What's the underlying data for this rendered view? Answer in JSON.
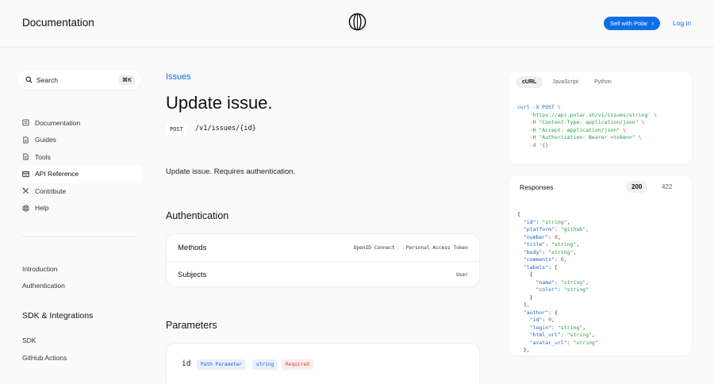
{
  "header": {
    "brand": "Documentation",
    "cta_label": "Sell with Polar",
    "login_label": "Log in",
    "accent": "#0d6fe8"
  },
  "sidebar": {
    "search": {
      "label": "Search",
      "shortcut": "⌘K"
    },
    "nav": [
      {
        "label": "Documentation",
        "icon": "book-icon"
      },
      {
        "label": "Guides",
        "icon": "file-icon"
      },
      {
        "label": "Tools",
        "icon": "file-icon"
      },
      {
        "label": "API Reference",
        "icon": "terminal-icon",
        "active": true
      },
      {
        "label": "Contribute",
        "icon": "tools-icon"
      },
      {
        "label": "Help",
        "icon": "lifebuoy-icon"
      }
    ],
    "links": [
      "Introduction",
      "Authentication"
    ],
    "section_title": "SDK & Integrations",
    "section_links": [
      "SDK",
      "GitHub Actions"
    ]
  },
  "main": {
    "breadcrumb": "Issues",
    "title": "Update issue.",
    "method": "POST",
    "path": "/v1/issues/{id}",
    "description": "Update issue. Requires authentication.",
    "auth_heading": "Authentication",
    "auth_rows": [
      {
        "key": "Methods",
        "values": [
          "OpenID Connect",
          "Personal Access Token"
        ]
      },
      {
        "key": "Subjects",
        "values": [
          "User"
        ]
      }
    ],
    "params_heading": "Parameters",
    "param": {
      "name": "id",
      "location": "Path Parameter",
      "type": "string",
      "required": "Required"
    }
  },
  "code_panel": {
    "tabs": [
      "cURL",
      "JavaScript",
      "Python"
    ],
    "active_tab": "cURL",
    "lines": [
      [
        [
          "curl -X POST ",
          "blue"
        ],
        [
          "\\",
          "red"
        ]
      ],
      [
        [
          "    'https://api.polar.sh/v1/issues/string' ",
          "green"
        ],
        [
          "\\",
          "red"
        ]
      ],
      [
        [
          "    -H \"Content-Type: application/json\" ",
          "green"
        ],
        [
          "\\",
          "red"
        ]
      ],
      [
        [
          "    -H \"Accept: application/json\" ",
          "green"
        ],
        [
          "\\",
          "red"
        ]
      ],
      [
        [
          "    -H \"Authorization: Bearer <token>\" ",
          "green"
        ],
        [
          "\\",
          "red"
        ]
      ],
      [
        [
          "    -d '{}'",
          "green"
        ]
      ]
    ]
  },
  "responses": {
    "title": "Responses",
    "tabs": [
      "200",
      "422"
    ],
    "active_tab": "200",
    "lines": [
      [
        [
          "{",
          "dark"
        ]
      ],
      [
        [
          "  \"id\"",
          "blue"
        ],
        [
          ": ",
          "dark"
        ],
        [
          "\"string\"",
          "green"
        ],
        [
          ",",
          "dark"
        ]
      ],
      [
        [
          "  \"platform\"",
          "blue"
        ],
        [
          ": ",
          "dark"
        ],
        [
          "\"github\"",
          "green"
        ],
        [
          ",",
          "dark"
        ]
      ],
      [
        [
          "  \"number\"",
          "blue"
        ],
        [
          ": ",
          "dark"
        ],
        [
          "0",
          "red"
        ],
        [
          ",",
          "dark"
        ]
      ],
      [
        [
          "  \"title\"",
          "blue"
        ],
        [
          ": ",
          "dark"
        ],
        [
          "\"string\"",
          "green"
        ],
        [
          ",",
          "dark"
        ]
      ],
      [
        [
          "  \"body\"",
          "blue"
        ],
        [
          ": ",
          "dark"
        ],
        [
          "\"string\"",
          "green"
        ],
        [
          ",",
          "dark"
        ]
      ],
      [
        [
          "  \"comments\"",
          "blue"
        ],
        [
          ": ",
          "dark"
        ],
        [
          "0",
          "red"
        ],
        [
          ",",
          "dark"
        ]
      ],
      [
        [
          "  \"labels\"",
          "blue"
        ],
        [
          ": [",
          "dark"
        ]
      ],
      [
        [
          "    {",
          "dark"
        ]
      ],
      [
        [
          "      \"name\"",
          "blue"
        ],
        [
          ": ",
          "dark"
        ],
        [
          "\"string\"",
          "green"
        ],
        [
          ",",
          "dark"
        ]
      ],
      [
        [
          "      \"color\"",
          "blue"
        ],
        [
          ": ",
          "dark"
        ],
        [
          "\"string\"",
          "green"
        ]
      ],
      [
        [
          "    }",
          "dark"
        ]
      ],
      [
        [
          "  ],",
          "dark"
        ]
      ],
      [
        [
          "  \"author\"",
          "blue"
        ],
        [
          ": {",
          "dark"
        ]
      ],
      [
        [
          "    \"id\"",
          "blue"
        ],
        [
          ": ",
          "dark"
        ],
        [
          "0",
          "red"
        ],
        [
          ",",
          "dark"
        ]
      ],
      [
        [
          "    \"login\"",
          "blue"
        ],
        [
          ": ",
          "dark"
        ],
        [
          "\"string\"",
          "green"
        ],
        [
          ",",
          "dark"
        ]
      ],
      [
        [
          "    \"html_url\"",
          "blue"
        ],
        [
          ": ",
          "dark"
        ],
        [
          "\"string\"",
          "green"
        ],
        [
          ",",
          "dark"
        ]
      ],
      [
        [
          "    \"avatar_url\"",
          "blue"
        ],
        [
          ": ",
          "dark"
        ],
        [
          "\"string\"",
          "green"
        ]
      ],
      [
        [
          "  },",
          "dark"
        ]
      ]
    ]
  }
}
